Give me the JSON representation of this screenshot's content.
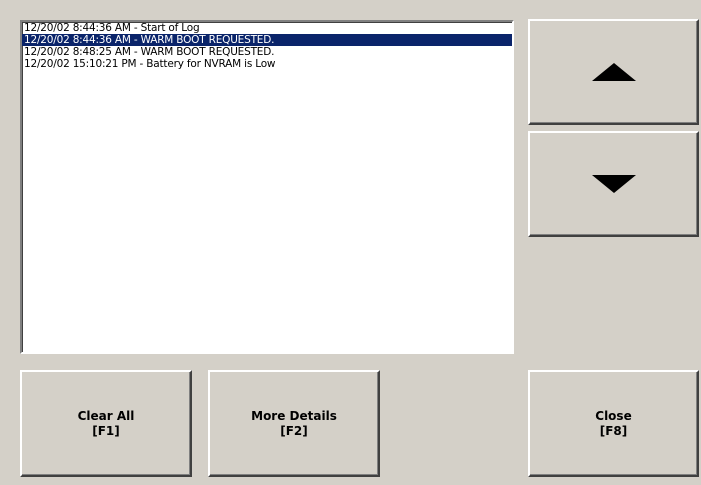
{
  "log": {
    "entries": [
      "12/20/02 8:44:36 AM - Start of Log",
      "12/20/02 8:44:36 AM - WARM BOOT REQUESTED.",
      "12/20/02 8:48:25 AM - WARM BOOT REQUESTED.",
      "12/20/02 15:10:21 PM - Battery for NVRAM is Low"
    ],
    "selected_index": 1
  },
  "scroll": {
    "up_icon": "up-arrow-icon",
    "down_icon": "down-arrow-icon"
  },
  "buttons": {
    "clear_all": {
      "label": "Clear All",
      "key": "[F1]"
    },
    "more_details": {
      "label": "More Details",
      "key": "[F2]"
    },
    "close": {
      "label": "Close",
      "key": "[F8]"
    }
  },
  "colors": {
    "background": "#d4d0c8",
    "selection": "#0a246a",
    "list_background": "#ffffff"
  }
}
